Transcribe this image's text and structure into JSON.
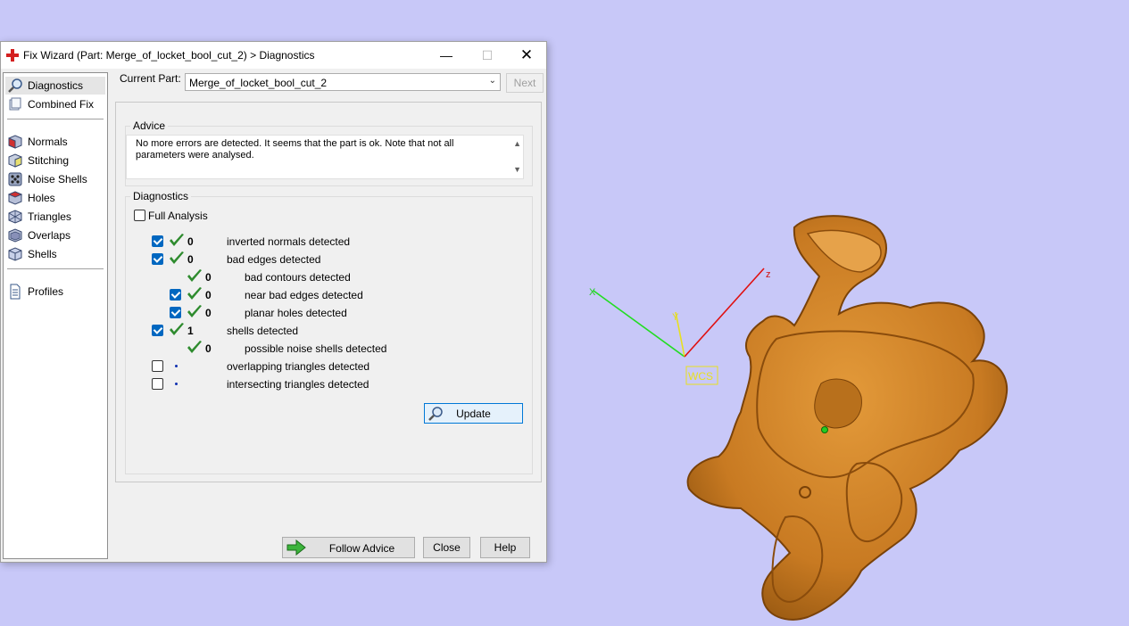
{
  "viewport": {
    "background": "#c8c8f8",
    "wcs_label": "WCS",
    "axes": {
      "x_label": "X",
      "y_label": "Y",
      "z_label": "z"
    }
  },
  "window": {
    "title": "Fix Wizard (Part: Merge_of_locket_bool_cut_2) > Diagnostics",
    "minimize": "—",
    "maximize": "☐",
    "close": "✕"
  },
  "sidebar": {
    "items": [
      {
        "label": "Diagnostics",
        "icon": "magnifier-icon",
        "selected": true
      },
      {
        "label": "Combined Fix",
        "icon": "combined-fix-icon"
      },
      {
        "label": "Normals",
        "icon": "normals-cube-icon"
      },
      {
        "label": "Stitching",
        "icon": "stitching-cube-icon"
      },
      {
        "label": "Noise Shells",
        "icon": "noise-shells-icon"
      },
      {
        "label": "Holes",
        "icon": "holes-cube-icon"
      },
      {
        "label": "Triangles",
        "icon": "triangles-icon"
      },
      {
        "label": "Overlaps",
        "icon": "overlaps-cube-icon"
      },
      {
        "label": "Shells",
        "icon": "shells-cube-icon"
      },
      {
        "label": "Profiles",
        "icon": "profiles-doc-icon"
      }
    ]
  },
  "current_part": {
    "label": "Current Part:",
    "value": "Merge_of_locket_bool_cut_2",
    "next_label": "Next"
  },
  "advice": {
    "title": "Advice",
    "text": "No more errors are detected. It seems that the part is ok. Note that not all parameters were analysed."
  },
  "diagnostics": {
    "title": "Diagnostics",
    "full_analysis_label": "Full Analysis",
    "full_analysis_checked": false,
    "rows": [
      {
        "checked": true,
        "has_checkbox": true,
        "status": "ok",
        "count": "0",
        "label": "inverted normals detected",
        "indent": 0
      },
      {
        "checked": true,
        "has_checkbox": true,
        "status": "ok",
        "count": "0",
        "label": "bad edges detected",
        "indent": 0
      },
      {
        "checked": false,
        "has_checkbox": false,
        "status": "ok",
        "count": "0",
        "label": "bad contours detected",
        "indent": 1
      },
      {
        "checked": true,
        "has_checkbox": true,
        "status": "ok",
        "count": "0",
        "label": "near bad edges detected",
        "indent": 1
      },
      {
        "checked": true,
        "has_checkbox": true,
        "status": "ok",
        "count": "0",
        "label": "planar holes detected",
        "indent": 1
      },
      {
        "checked": true,
        "has_checkbox": true,
        "status": "ok",
        "count": "1",
        "label": "shells detected",
        "indent": 0
      },
      {
        "checked": false,
        "has_checkbox": false,
        "status": "ok",
        "count": "0",
        "label": "possible noise shells detected",
        "indent": 1
      },
      {
        "checked": false,
        "has_checkbox": true,
        "status": "pending",
        "count": "",
        "label": "overlapping triangles detected",
        "indent": 0
      },
      {
        "checked": false,
        "has_checkbox": true,
        "status": "pending",
        "count": "",
        "label": "intersecting triangles detected",
        "indent": 0
      }
    ],
    "update_label": "Update"
  },
  "footer": {
    "follow_advice_label": "Follow Advice",
    "close_label": "Close",
    "help_label": "Help"
  },
  "colors": {
    "check_green": "#2e8b2e",
    "checkbox_blue": "#0067c0",
    "model_orange": "#d98a2b"
  }
}
